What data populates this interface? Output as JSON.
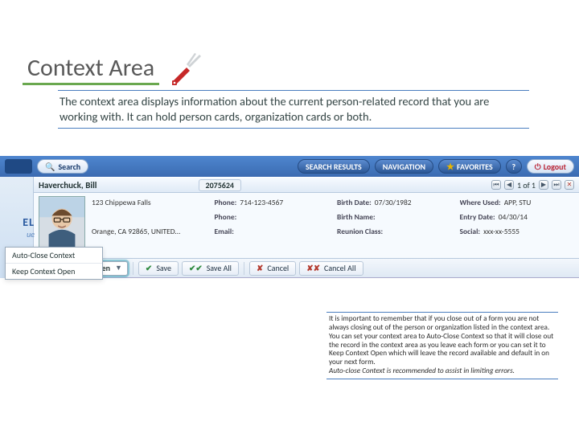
{
  "title": "Context Area",
  "intro": "The context area displays information about the current person-related record that you are working with. It can hold  person cards, organization cards or both.",
  "topbar": {
    "search": "Search",
    "results": "SEARCH RESULTS",
    "navigation": "NAVIGATION",
    "favorites": "FAVORITES",
    "help": "?",
    "logout": "Logout"
  },
  "left": {
    "brand1": "EL",
    "brand2": "ue"
  },
  "card": {
    "name": "Haverchuck, Bill",
    "id": "2075624",
    "counter": "1 of 1",
    "address": "123 Chippewa Falls",
    "citystate": "Orange, CA 92865, UNITED…",
    "phone_label": "Phone:",
    "phone": "714-123-4567",
    "phone2_label": "Phone:",
    "phone2": "",
    "email_label": "Email:",
    "email": "",
    "bdate_label": "Birth Date:",
    "bdate": "07/30/1982",
    "bname_label": "Birth Name:",
    "bname": "",
    "reunion_label": "Reunion Class:",
    "reunion": "",
    "where_label": "Where Used:",
    "where": "APP, STU",
    "entry_label": "Entry Date:",
    "entry": "04/30/14",
    "social_label": "Social:",
    "social": "xxx-xx-5555"
  },
  "actions": {
    "keep": "Keep Context Open",
    "save": "Save",
    "saveall": "Save All",
    "cancel": "Cancel",
    "cancelall": "Cancel All"
  },
  "menu": {
    "auto": "Auto-Close Context",
    "keep": "Keep Context Open"
  },
  "note": "It is important to remember that if you close out of a form you are not always closing out of the person or organization listed in the context area. You can set your context area to Auto-Close Context so that it will close out the record in the context area as you leave each form or you can set it to Keep Context Open which will leave the record available and default in on your next form.",
  "note2": "Auto-close Context is recommended to assist in limiting errors."
}
